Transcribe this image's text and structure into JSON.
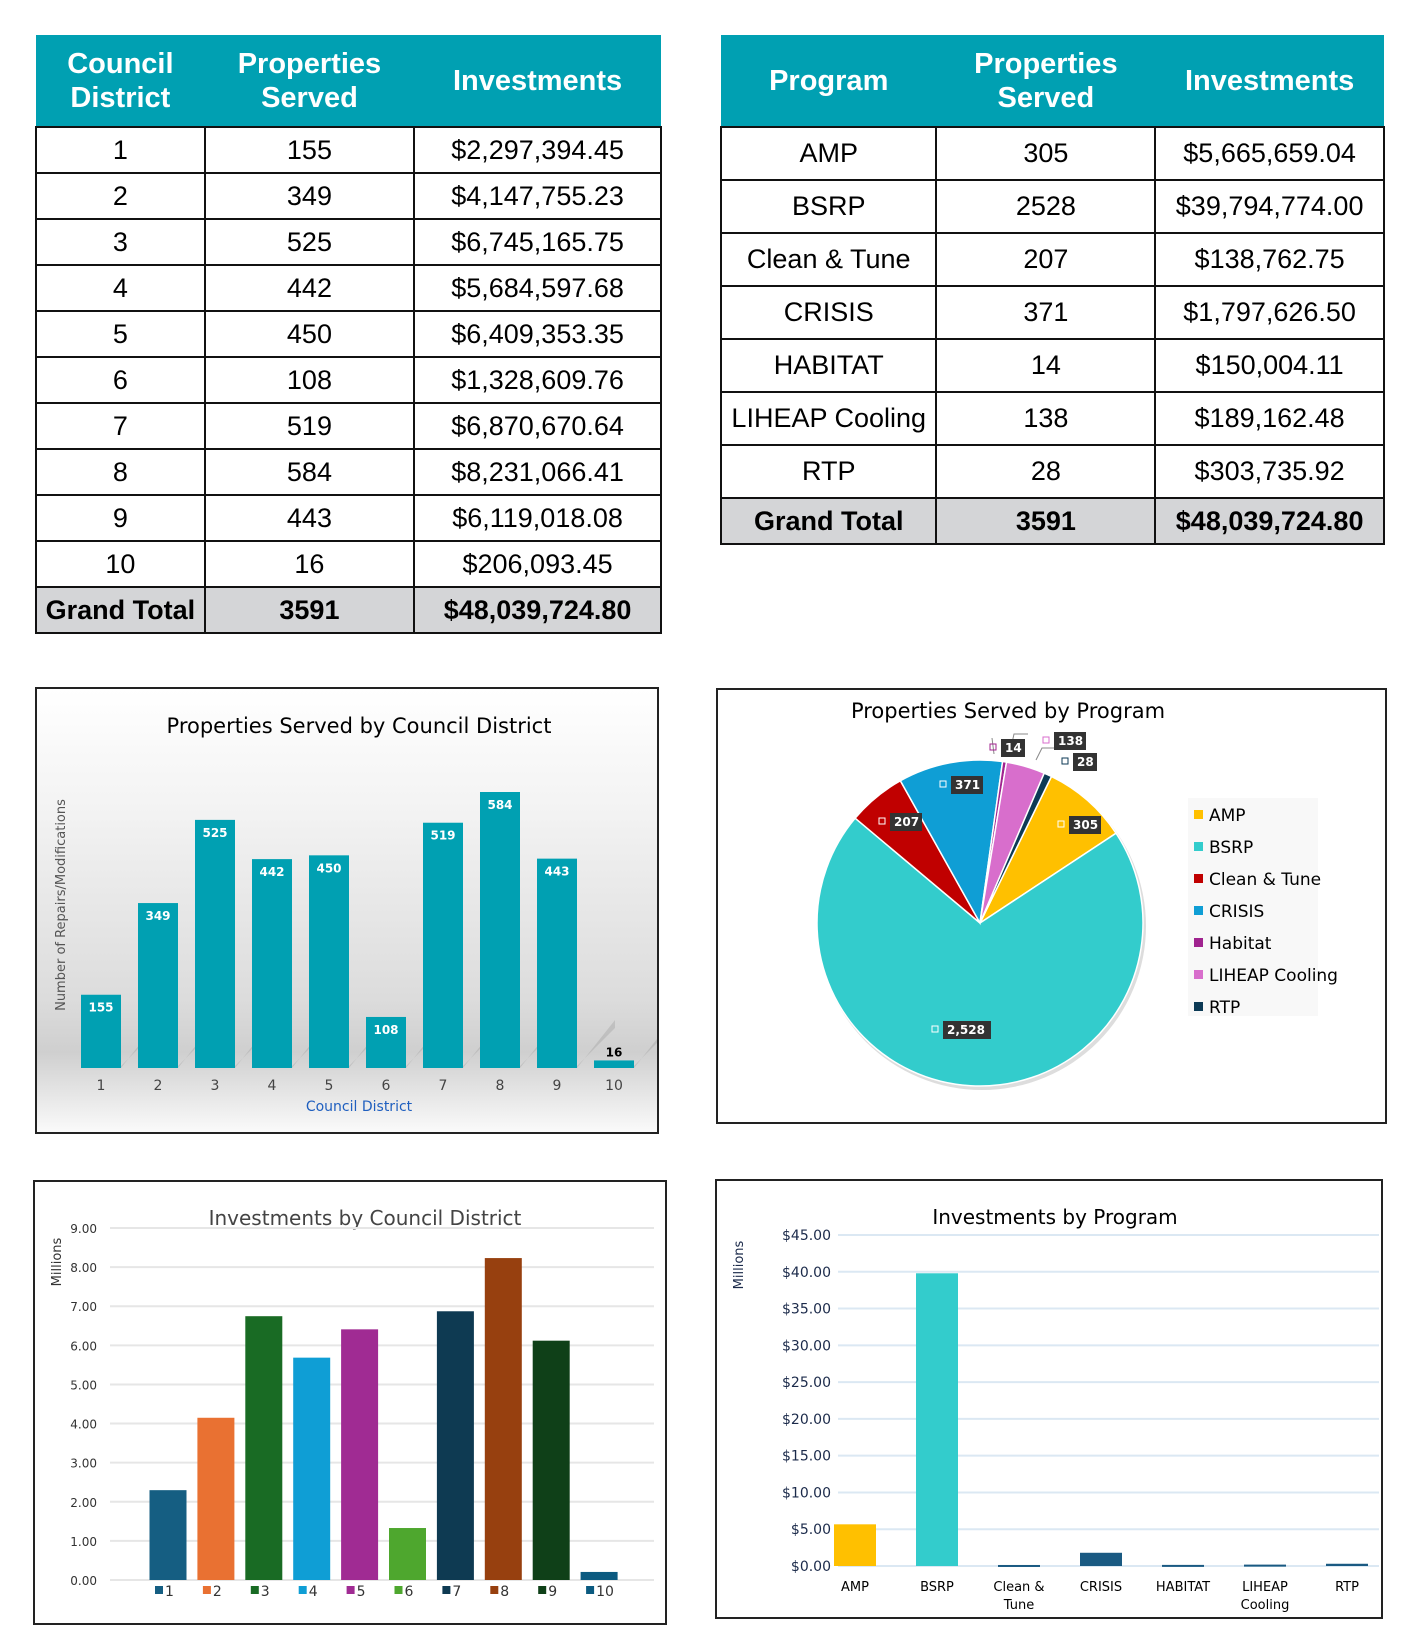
{
  "district_table": {
    "headers": [
      "Council District",
      "Properties Served",
      "Investments"
    ],
    "rows": [
      [
        "1",
        "155",
        "$2,297,394.45"
      ],
      [
        "2",
        "349",
        "$4,147,755.23"
      ],
      [
        "3",
        "525",
        "$6,745,165.75"
      ],
      [
        "4",
        "442",
        "$5,684,597.68"
      ],
      [
        "5",
        "450",
        "$6,409,353.35"
      ],
      [
        "6",
        "108",
        "$1,328,609.76"
      ],
      [
        "7",
        "519",
        "$6,870,670.64"
      ],
      [
        "8",
        "584",
        "$8,231,066.41"
      ],
      [
        "9",
        "443",
        "$6,119,018.08"
      ],
      [
        "10",
        "16",
        "$206,093.45"
      ]
    ],
    "total": [
      "Grand Total",
      "3591",
      "$48,039,724.80"
    ]
  },
  "program_table": {
    "headers": [
      "Program",
      "Properties Served",
      "Investments"
    ],
    "rows": [
      [
        "AMP",
        "305",
        "$5,665,659.04"
      ],
      [
        "BSRP",
        "2528",
        "$39,794,774.00"
      ],
      [
        "Clean & Tune",
        "207",
        "$138,762.75"
      ],
      [
        "CRISIS",
        "371",
        "$1,797,626.50"
      ],
      [
        "HABITAT",
        "14",
        "$150,004.11"
      ],
      [
        "LIHEAP Cooling",
        "138",
        "$189,162.48"
      ],
      [
        "RTP",
        "28",
        "$303,735.92"
      ]
    ],
    "total": [
      "Grand Total",
      "3591",
      "$48,039,724.80"
    ]
  },
  "colors": {
    "header_bg": "#00a0b2",
    "total_bg": "#d4d5d7"
  },
  "chart_data": [
    {
      "type": "bar",
      "title": "Properties Served by Council District",
      "xlabel": "Council District",
      "ylabel": "Number of Repairs/Modifications",
      "categories": [
        "1",
        "2",
        "3",
        "4",
        "5",
        "6",
        "7",
        "8",
        "9",
        "10"
      ],
      "values": [
        155,
        349,
        525,
        442,
        450,
        108,
        519,
        584,
        443,
        16
      ],
      "data_labels": [
        "155",
        "349",
        "525",
        "442",
        "450",
        "108",
        "519",
        "584",
        "443",
        "16"
      ],
      "color": "#00a0b2",
      "grid": false
    },
    {
      "type": "pie",
      "title": "Properties Served by Program",
      "categories": [
        "AMP",
        "BSRP",
        "Clean & Tune",
        "CRISIS",
        "Habitat",
        "LIHEAP Cooling",
        "RTP"
      ],
      "values": [
        305,
        2528,
        207,
        371,
        14,
        138,
        28
      ],
      "data_labels": [
        "305",
        "2,528",
        "207",
        "371",
        "14",
        "138",
        "28"
      ],
      "colors": [
        "#ffc000",
        "#33cccc",
        "#c00000",
        "#0f9ed5",
        "#a0238f",
        "#d86ecc",
        "#0c3a55"
      ],
      "legend": "right"
    },
    {
      "type": "bar",
      "title": "Investments by Council District",
      "ylabel": "Millions",
      "categories": [
        "1",
        "2",
        "3",
        "4",
        "5",
        "6",
        "7",
        "8",
        "9",
        "10"
      ],
      "values": [
        2.297,
        4.148,
        6.745,
        5.685,
        6.409,
        1.329,
        6.871,
        8.231,
        6.119,
        0.206
      ],
      "colors": [
        "#155e82",
        "#e97132",
        "#196b24",
        "#0f9ed5",
        "#a02b93",
        "#4ea72e",
        "#0e3a52",
        "#97400f",
        "#0f4018",
        "#0b5a80"
      ],
      "yticks": [
        "0.00",
        "1.00",
        "2.00",
        "3.00",
        "4.00",
        "5.00",
        "6.00",
        "7.00",
        "8.00",
        "9.00"
      ],
      "ylim": [
        0,
        9
      ],
      "grid": true,
      "legend": "bottom"
    },
    {
      "type": "bar",
      "title": "Investments by Program",
      "ylabel": "Millions",
      "categories": [
        "AMP",
        "BSRP",
        "Clean & Tune",
        "CRISIS",
        "HABITAT",
        "LIHEAP Cooling",
        "RTP"
      ],
      "category_lines": [
        [
          "AMP"
        ],
        [
          "BSRP"
        ],
        [
          "Clean &",
          "Tune"
        ],
        [
          "CRISIS"
        ],
        [
          "HABITAT"
        ],
        [
          "LIHEAP",
          "Cooling"
        ],
        [
          "RTP"
        ]
      ],
      "values": [
        5.666,
        39.795,
        0.139,
        1.798,
        0.15,
        0.189,
        0.304
      ],
      "colors": [
        "#ffc000",
        "#33cccc",
        "#1a5a82",
        "#1a5a82",
        "#1a5a82",
        "#1a5a82",
        "#1a5a82"
      ],
      "yticks": [
        "$0.00",
        "$5.00",
        "$10.00",
        "$15.00",
        "$20.00",
        "$25.00",
        "$30.00",
        "$35.00",
        "$40.00",
        "$45.00"
      ],
      "ylim": [
        0,
        45
      ],
      "grid": true
    }
  ]
}
